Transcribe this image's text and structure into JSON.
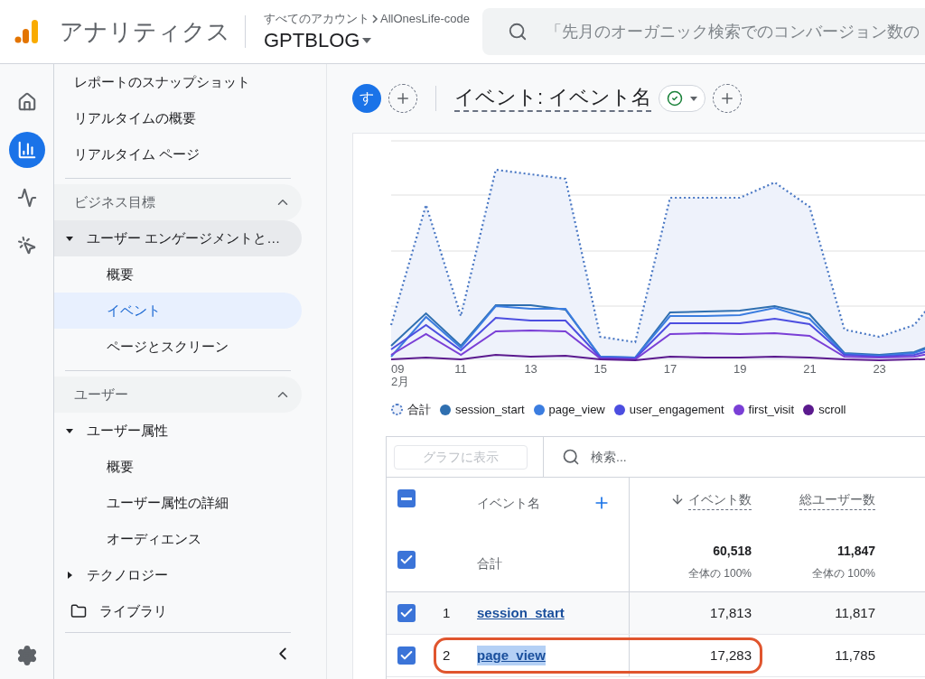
{
  "top_bar": {
    "app_name": "アナリティクス",
    "breadcrumb_account": "すべてのアカウント",
    "breadcrumb_property": "AllOnesLife-code",
    "property": "GPTBLOG",
    "search": {
      "placeholder": "「先月のオーガニック検索でのコンバージョン数の"
    }
  },
  "rail": [
    {
      "kind": "home",
      "selected": false
    },
    {
      "kind": "reports",
      "selected": true
    },
    {
      "kind": "explore",
      "selected": false
    },
    {
      "kind": "advertising",
      "selected": false
    }
  ],
  "sidebar": {
    "top_items": [
      {
        "label": "レポートのスナップショット"
      },
      {
        "label": "リアルタイムの概要"
      },
      {
        "label": "リアルタイム ページ"
      }
    ],
    "sections": [
      {
        "title": "ビジネス目標",
        "expanded": true,
        "groups": [
          {
            "label": "ユーザー エンゲージメントと…",
            "expanded": true,
            "children": [
              {
                "label": "概要",
                "selected": false
              },
              {
                "label": "イベント",
                "selected": true
              },
              {
                "label": "ページとスクリーン",
                "selected": false
              }
            ]
          }
        ]
      },
      {
        "title": "ユーザー",
        "expanded": true,
        "groups": [
          {
            "label": "ユーザー属性",
            "expanded": true,
            "children": [
              {
                "label": "概要",
                "selected": false
              },
              {
                "label": "ユーザー属性の詳細",
                "selected": false
              },
              {
                "label": "オーディエンス",
                "selected": false
              }
            ]
          },
          {
            "label": "テクノロジー",
            "expanded": false
          }
        ]
      }
    ],
    "library": {
      "label": "ライブラリ"
    }
  },
  "header": {
    "avatar_letter": "す",
    "title": "イベント: イベント名"
  },
  "chart": {
    "x_labels": [
      {
        "label": "09",
        "sub": "2月"
      },
      {
        "label": "11"
      },
      {
        "label": "13"
      },
      {
        "label": "15"
      },
      {
        "label": "17"
      },
      {
        "label": "19"
      },
      {
        "label": "21"
      },
      {
        "label": "23"
      }
    ],
    "legend": [
      {
        "label": "合計",
        "color": "#4a78c4",
        "kind": "dotted"
      },
      {
        "label": "session_start",
        "color": "#2f6fb0",
        "kind": "solid"
      },
      {
        "label": "page_view",
        "color": "#3b7de0",
        "kind": "solid"
      },
      {
        "label": "user_engagement",
        "color": "#4c4ee0",
        "kind": "solid"
      },
      {
        "label": "first_visit",
        "color": "#7a3fd6",
        "kind": "solid"
      },
      {
        "label": "scroll",
        "color": "#5b1a8e",
        "kind": "solid"
      }
    ]
  },
  "table": {
    "graph_button": {
      "label": "グラフに表示",
      "disabled": true
    },
    "search": {
      "placeholder": "検索..."
    },
    "header_checkbox": {
      "indeterminate": true
    },
    "columns": [
      {
        "label": "イベント名",
        "sorted": false
      },
      {
        "label": "イベント数",
        "sorted": true
      },
      {
        "label": "総ユーザー数",
        "sorted": false
      }
    ],
    "total": {
      "label": "合計",
      "checked": true,
      "values": [
        {
          "value": "60,518",
          "share": "全体の 100%"
        },
        {
          "value": "11,847",
          "share": "全体の 100%"
        }
      ]
    },
    "rows": [
      {
        "rank": "1",
        "name": "session_start",
        "checked": true,
        "text_selected": false,
        "circled": false,
        "values": [
          "17,813",
          "11,817"
        ]
      },
      {
        "rank": "2",
        "name": "page_view",
        "checked": true,
        "text_selected": true,
        "circled": true,
        "values": [
          "17,283",
          "11,785"
        ]
      }
    ]
  }
}
